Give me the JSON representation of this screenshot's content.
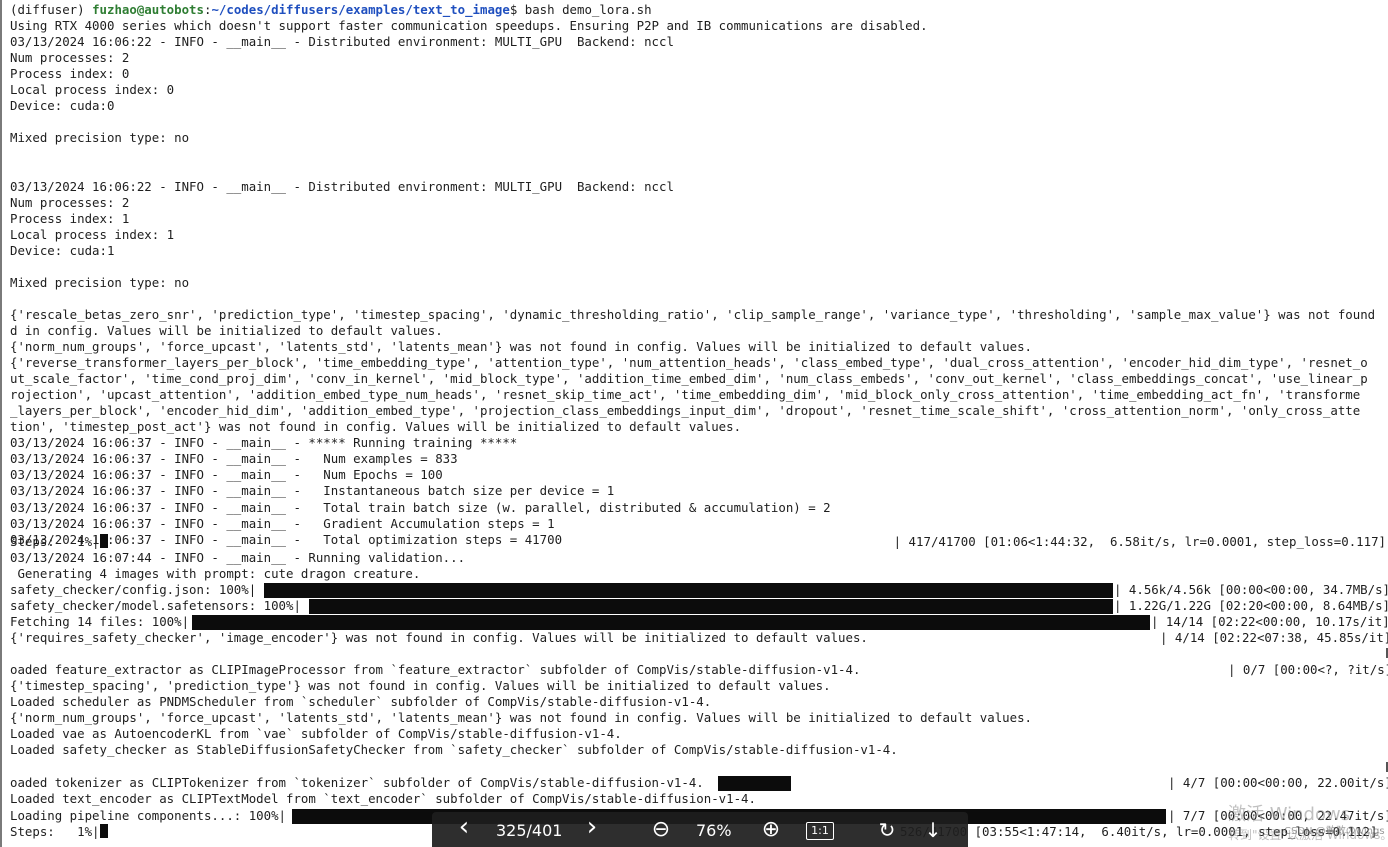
{
  "terminal": {
    "prompt": {
      "env": "(diffuser) ",
      "user_host": "fuzhao@autobots",
      "sep": ":",
      "path": "~/codes/diffusers/examples/text_to_image",
      "symbol": "$ ",
      "command": "bash demo_lora.sh"
    },
    "lines": [
      "Using RTX 4000 series which doesn't support faster communication speedups. Ensuring P2P and IB communications are disabled.",
      "03/13/2024 16:06:22 - INFO - __main__ - Distributed environment: MULTI_GPU  Backend: nccl",
      "Num processes: 2",
      "Process index: 0",
      "Local process index: 0",
      "Device: cuda:0",
      "",
      "Mixed precision type: no",
      "",
      "",
      "03/13/2024 16:06:22 - INFO - __main__ - Distributed environment: MULTI_GPU  Backend: nccl",
      "Num processes: 2",
      "Process index: 1",
      "Local process index: 1",
      "Device: cuda:1",
      "",
      "Mixed precision type: no",
      "",
      "{'rescale_betas_zero_snr', 'prediction_type', 'timestep_spacing', 'dynamic_thresholding_ratio', 'clip_sample_range', 'variance_type', 'thresholding', 'sample_max_value'} was not found",
      "d in config. Values will be initialized to default values.",
      "{'norm_num_groups', 'force_upcast', 'latents_std', 'latents_mean'} was not found in config. Values will be initialized to default values.",
      "{'reverse_transformer_layers_per_block', 'time_embedding_type', 'attention_type', 'num_attention_heads', 'class_embed_type', 'dual_cross_attention', 'encoder_hid_dim_type', 'resnet_o",
      "ut_scale_factor', 'time_cond_proj_dim', 'conv_in_kernel', 'mid_block_type', 'addition_time_embed_dim', 'num_class_embeds', 'conv_out_kernel', 'class_embeddings_concat', 'use_linear_p",
      "rojection', 'upcast_attention', 'addition_embed_type_num_heads', 'resnet_skip_time_act', 'time_embedding_dim', 'mid_block_only_cross_attention', 'time_embedding_act_fn', 'transforme",
      "_layers_per_block', 'encoder_hid_dim', 'addition_embed_type', 'projection_class_embeddings_input_dim', 'dropout', 'resnet_time_scale_shift', 'cross_attention_norm', 'only_cross_atte",
      "tion', 'timestep_post_act'} was not found in config. Values will be initialized to default values.",
      "03/13/2024 16:06:37 - INFO - __main__ - ***** Running training *****",
      "03/13/2024 16:06:37 - INFO - __main__ -   Num examples = 833",
      "03/13/2024 16:06:37 - INFO - __main__ -   Num Epochs = 100",
      "03/13/2024 16:06:37 - INFO - __main__ -   Instantaneous batch size per device = 1",
      "03/13/2024 16:06:37 - INFO - __main__ -   Total train batch size (w. parallel, distributed & accumulation) = 2",
      "03/13/2024 16:06:37 - INFO - __main__ -   Gradient Accumulation steps = 1",
      "03/13/2024 16:06:37 - INFO - __main__ -   Total optimization steps = 41700"
    ],
    "steps_line": {
      "label": "Steps:   1%|",
      "status": "| 417/41700 [01:06<1:44:32,  6.58it/s, lr=0.0001, step_loss=0.117]"
    },
    "validation_line": "03/13/2024 16:07:44 - INFO - __main__ - Running validation...",
    "generating_line": " Generating 4 images with prompt: cute dragon creature.",
    "progress": [
      {
        "label": "safety_checker/config.json: 100%|",
        "status": "| 4.56k/4.56k [00:00<00:00, 34.7MB/s]",
        "fraction": 1.0
      },
      {
        "label": "safety_checker/model.safetensors: 100%|",
        "status": "| 1.22G/1.22G [02:20<00:00, 8.64MB/s]",
        "fraction": 1.0
      },
      {
        "label": "Fetching 14 files: 100%|",
        "status": "| 14/14 [02:22<00:00, 10.17s/it]",
        "fraction": 1.0
      }
    ],
    "not_found_line": "{'requires_safety_checker', 'image_encoder'} was not found in config. Values will be initialized to default values.",
    "not_found_status": "| 4/14 [02:22<07:38, 45.85s/it]",
    "loaded_lines": [
      "oaded feature_extractor as CLIPImageProcessor from `feature_extractor` subfolder of CompVis/stable-diffusion-v1-4.",
      "{'timestep_spacing', 'prediction_type'} was not found in config. Values will be initialized to default values.",
      "Loaded scheduler as PNDMScheduler from `scheduler` subfolder of CompVis/stable-diffusion-v1-4.",
      "{'norm_num_groups', 'force_upcast', 'latents_std', 'latents_mean'} was not found in config. Values will be initialized to default values.",
      "Loaded vae as AutoencoderKL from `vae` subfolder of CompVis/stable-diffusion-v1-4.",
      "Loaded safety_checker as StableDiffusionSafetyChecker from `safety_checker` subfolder of CompVis/stable-diffusion-v1-4."
    ],
    "feature_extractor_status": "| 0/7 [00:00<?, ?it/s]",
    "tokenizer_line": "oaded tokenizer as CLIPTokenizer from `tokenizer` subfolder of CompVis/stable-diffusion-v1-4.",
    "tokenizer_status": "| 4/7 [00:00<00:00, 22.00it/s]",
    "text_encoder_line": "Loaded text_encoder as CLIPTextModel from `text_encoder` subfolder of CompVis/stable-diffusion-v1-4.",
    "pipeline_line": {
      "label": "Loading pipeline components...: 100%|",
      "status": "| 7/7 [00:00<00:00, 22.47it/s]"
    },
    "steps_line2": {
      "label": "Steps:   1%|",
      "status": "526/41700 [03:55<1:47:14,  6.40it/s, lr=0.0001, step_loss=0.112]"
    }
  },
  "viewer": {
    "prev_label": "‹",
    "page_indicator": "325/401",
    "next_label": "›",
    "zoom_out_label": "⊖",
    "zoom_level": "76%",
    "zoom_in_label": "⊕",
    "fit_label": "1:1",
    "rotate_label": "↻",
    "download_label": "↓"
  },
  "watermark": {
    "line1": "激活 Windows",
    "line2": "转到\"设置\"以激活 Windows。",
    "csdn": "CSDN @敢敢のwings"
  },
  "colors": {
    "user_host": "#2e7d32",
    "path": "#1f4fbf",
    "bar": "#0c0c0c"
  }
}
